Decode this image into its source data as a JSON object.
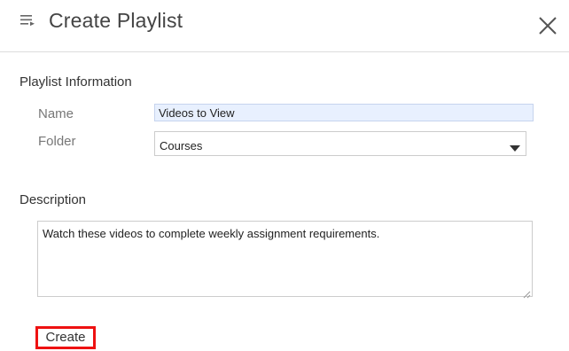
{
  "header": {
    "title": "Create Playlist",
    "menu_icon": "playlist-menu-icon",
    "close_icon": "close-icon"
  },
  "playlist_information": {
    "heading": "Playlist Information",
    "name_label": "Name",
    "name_value": "Videos to View",
    "folder_label": "Folder",
    "folder_value": "Courses"
  },
  "description": {
    "heading": "Description",
    "value": "Watch these videos to complete weekly assignment requirements."
  },
  "actions": {
    "create_label": "Create"
  },
  "colors": {
    "name_field_bg": "#e8f0fe",
    "create_highlight": "#ee1111"
  }
}
